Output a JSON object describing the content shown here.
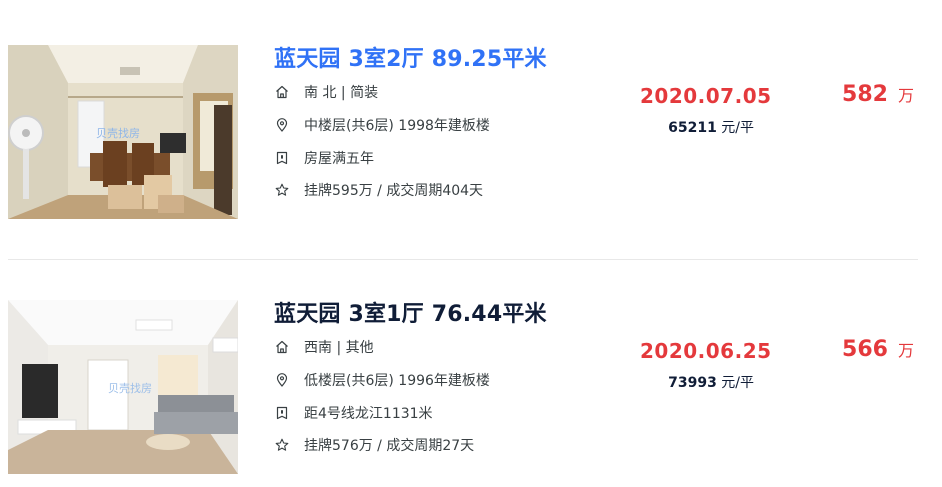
{
  "listings": [
    {
      "title": "蓝天园 3室2厅 89.25平米",
      "house_info": "南 北 | 简装",
      "position_info": "中楼层(共6层) 1998年建板楼",
      "tag": "房屋满五年",
      "deal_cycle": "挂牌595万 / 成交周期404天",
      "deal_date": "2020.07.05",
      "unit_price_value": "65211",
      "unit_price_unit": "元/平",
      "total_price_value": "582",
      "total_price_unit": "万",
      "watermark": "贝壳找房"
    },
    {
      "title": "蓝天园 3室1厅 76.44平米",
      "house_info": "西南 | 其他",
      "position_info": "低楼层(共6层) 1996年建板楼",
      "tag": "距4号线龙江1131米",
      "deal_cycle": "挂牌576万 / 成交周期27天",
      "deal_date": "2020.06.25",
      "unit_price_value": "73993",
      "unit_price_unit": "元/平",
      "total_price_value": "566",
      "total_price_unit": "万",
      "watermark": "贝壳找房"
    }
  ],
  "icons": {
    "house": "house-icon",
    "location": "location-pin-icon",
    "tag": "shield-tag-icon",
    "star": "star-icon"
  },
  "colors": {
    "title_hover": "#3072f6",
    "title": "#101d37",
    "price": "#e4393c",
    "text": "#394043"
  }
}
